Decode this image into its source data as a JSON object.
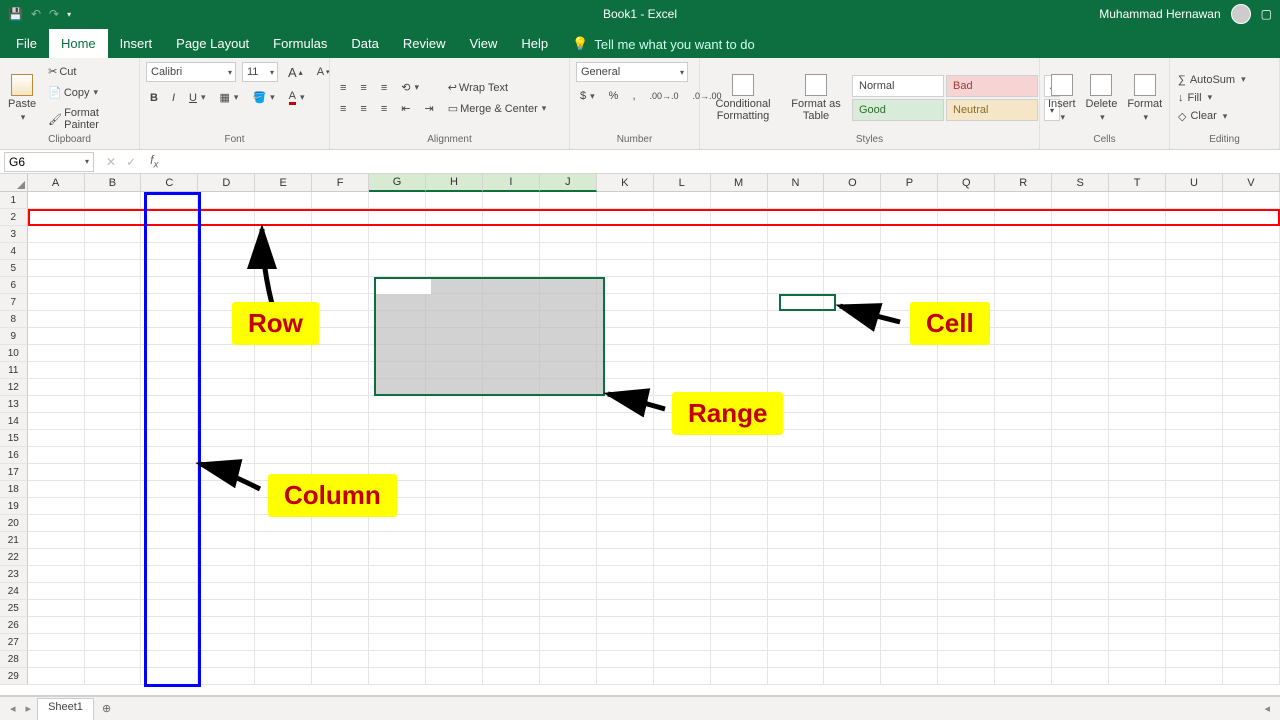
{
  "titlebar": {
    "title": "Book1 - Excel",
    "user": "Muhammad Hernawan"
  },
  "tabs": [
    "File",
    "Home",
    "Insert",
    "Page Layout",
    "Formulas",
    "Data",
    "Review",
    "View",
    "Help"
  ],
  "active_tab": "Home",
  "tellme": "Tell me what you want to do",
  "clipboard": {
    "cut": "Cut",
    "copy": "Copy",
    "paste": "Paste",
    "fp": "Format Painter",
    "label": "Clipboard"
  },
  "font": {
    "name": "Calibri",
    "size": "11",
    "label": "Font"
  },
  "alignment": {
    "wrap": "Wrap Text",
    "merge": "Merge & Center",
    "label": "Alignment"
  },
  "number": {
    "format": "General",
    "label": "Number"
  },
  "stylesgrp": {
    "cond": "Conditional Formatting",
    "fat": "Format as Table",
    "label": "Styles",
    "cells": [
      "Normal",
      "Bad",
      "Good",
      "Neutral"
    ]
  },
  "cells": {
    "insert": "Insert",
    "delete": "Delete",
    "format": "Format",
    "label": "Cells"
  },
  "editing": {
    "sum": "AutoSum",
    "fill": "Fill",
    "clear": "Clear",
    "label": "Editing"
  },
  "namebox": "G6",
  "columns": [
    "A",
    "B",
    "C",
    "D",
    "E",
    "F",
    "G",
    "H",
    "I",
    "J",
    "K",
    "L",
    "M",
    "N",
    "O",
    "P",
    "Q",
    "R",
    "S",
    "T",
    "U",
    "V"
  ],
  "sel_cols": [
    "G",
    "H",
    "I",
    "J"
  ],
  "rows": 29,
  "sheets": [
    "Sheet1"
  ],
  "labels": {
    "row": "Row",
    "column": "Column",
    "range": "Range",
    "cell": "Cell"
  }
}
